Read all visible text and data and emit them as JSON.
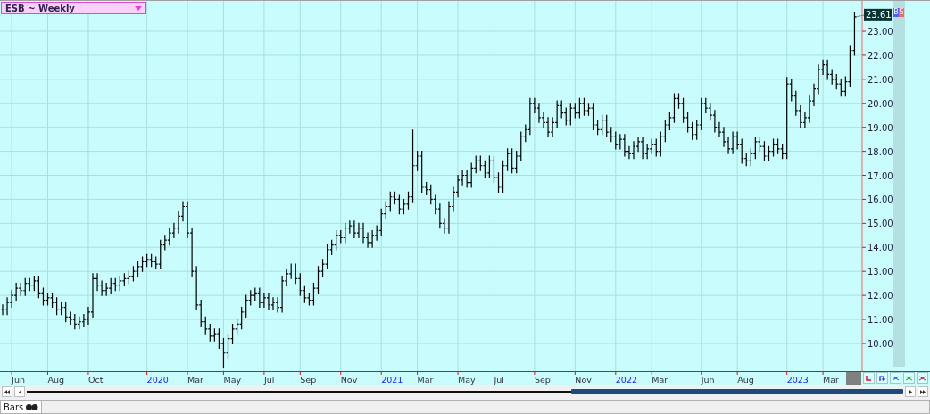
{
  "symbol_menu": {
    "label": "ESB ~ Weekly"
  },
  "chart": {
    "last_price": "23.61",
    "trade_tags": [
      {
        "label": "B",
        "color": "#5060ff"
      },
      {
        "label": "S",
        "color": "#ff6060"
      }
    ],
    "price_axis": {
      "labels": [
        "23.00",
        "22.00",
        "21.00",
        "20.00",
        "19.00",
        "18.00",
        "17.00",
        "16.00",
        "15.00",
        "14.00",
        "13.00",
        "12.00",
        "11.00",
        "10.00"
      ]
    },
    "date_axis": {
      "labels": [
        {
          "label": "Jun",
          "kind": "month"
        },
        {
          "label": "Aug",
          "kind": "month"
        },
        {
          "label": "Oct",
          "kind": "month"
        },
        {
          "label": "2020",
          "kind": "year"
        },
        {
          "label": "Mar",
          "kind": "month"
        },
        {
          "label": "May",
          "kind": "month"
        },
        {
          "label": "Jul",
          "kind": "month"
        },
        {
          "label": "Sep",
          "kind": "month"
        },
        {
          "label": "Nov",
          "kind": "month"
        },
        {
          "label": "2021",
          "kind": "year"
        },
        {
          "label": "Mar",
          "kind": "month"
        },
        {
          "label": "May",
          "kind": "month"
        },
        {
          "label": "Jul",
          "kind": "month"
        },
        {
          "label": "Sep",
          "kind": "month"
        },
        {
          "label": "Nov",
          "kind": "month"
        },
        {
          "label": "2022",
          "kind": "year"
        },
        {
          "label": "Mar",
          "kind": "month"
        },
        {
          "label": "Jun",
          "kind": "month"
        },
        {
          "label": "Aug",
          "kind": "month"
        },
        {
          "label": "2023",
          "kind": "year"
        },
        {
          "label": "Mar",
          "kind": "month"
        }
      ]
    }
  },
  "bottom_tabs": [
    {
      "label": "Bars",
      "selected": true
    }
  ]
}
